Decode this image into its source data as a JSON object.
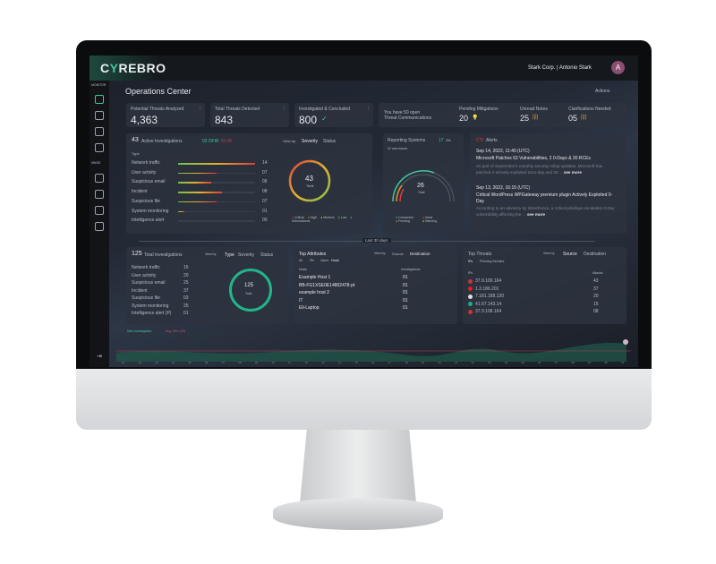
{
  "brand": {
    "logo": "CYREBRO"
  },
  "header": {
    "account": "Stark Corp. | Antonio Stark",
    "avatar": "A"
  },
  "sidebar": {
    "monitor": "MONITOR",
    "manage": "MNGE",
    "icons": [
      "activity-icon",
      "search-doc-icon",
      "cloud-icon",
      "grid-icon",
      "user-icon",
      "doc-icon",
      "shield-icon",
      "settings-icon"
    ]
  },
  "page": {
    "title": "Operations Center",
    "actions": "Actions"
  },
  "stats": [
    {
      "label": "Potential Threats Analyzed",
      "value": "4,363"
    },
    {
      "label": "Total Threats Detected",
      "value": "843"
    },
    {
      "label": "Investigated & Concluded",
      "value": "800"
    }
  ],
  "comms": {
    "text1": "You have 50 open",
    "text2": "Threat Communications",
    "items": [
      {
        "label": "Pending Mitigations",
        "value": "20"
      },
      {
        "label": "Unread Notes",
        "value": "25"
      },
      {
        "label": "Clarifications Needed",
        "value": "05"
      }
    ]
  },
  "active": {
    "count": "43",
    "label": "Active Investigations",
    "dfir": "02 DFIR",
    "ir": "01 IR",
    "viewby": "View by:",
    "tabs": [
      "Severity",
      "Status"
    ],
    "type_header": "Type",
    "total": "43",
    "total_label": "Total",
    "rows": [
      {
        "label": "Network traffic",
        "value": "14",
        "pct": 100
      },
      {
        "label": "User activity",
        "value": "07",
        "pct": 50
      },
      {
        "label": "Suspicious email",
        "value": "06",
        "pct": 43
      },
      {
        "label": "Incident",
        "value": "08",
        "pct": 57
      },
      {
        "label": "Suspicious file",
        "value": "07",
        "pct": 50
      },
      {
        "label": "System monitoring",
        "value": "01",
        "pct": 8
      },
      {
        "label": "Intelligence alert",
        "value": "00",
        "pct": 0
      }
    ],
    "legend": [
      "Critical",
      "High",
      "Medium",
      "Low",
      "Informational"
    ]
  },
  "reporting": {
    "title": "Reporting Systems",
    "count": "17",
    "of": "/26",
    "sub": "02 new issues",
    "total": "26",
    "total_label": "Total",
    "legend": [
      "Connected",
      "None",
      "Pending",
      "Warning"
    ]
  },
  "cti": {
    "title_accent": "CTI",
    "title": "Alerts",
    "alerts": [
      {
        "date": "Sep 14, 2022, 11:40 (UTC)",
        "title": "Microsoft Patches 63 Vulnerabilities, 2 0-Days & 30 RCEs",
        "body": "As part of September's monthly security rollup updates, Microsoft has patched 2 actively exploited Zero-day and 30 ...",
        "more": "see more"
      },
      {
        "date": "Sep 13, 2022, 16:15 (UTC)",
        "title": "Critical WordPress WPGateway premium plugin Actively Exploited 0-Day",
        "body": "According to an advisory by WordFence, a critical privilege escalation 0-Day vulnerability affecting the ...",
        "more": "see more"
      }
    ]
  },
  "range": "Last 30 days",
  "total_inv": {
    "count": "125",
    "label": "Total Investigations",
    "viewby": "View by:",
    "tabs": [
      "Type",
      "Severity",
      "Status"
    ],
    "total": "125",
    "total_label": "Total",
    "rows": [
      {
        "label": "Network traffic",
        "value": "15"
      },
      {
        "label": "User activity",
        "value": "20"
      },
      {
        "label": "Suspicious email",
        "value": "25"
      },
      {
        "label": "Incident",
        "value": "37"
      },
      {
        "label": "Suspicious file",
        "value": "03"
      },
      {
        "label": "System monitoring",
        "value": "25"
      },
      {
        "label": "Intelligence alert (P)",
        "value": "01"
      }
    ]
  },
  "attributes": {
    "title": "Top Attributes",
    "viewby": "View by:",
    "tabs": [
      "Source",
      "Destination"
    ],
    "filters": [
      "All",
      "IPs",
      "Users",
      "Hosts"
    ],
    "col1": "Hosts",
    "col2": "Investigations",
    "rows": [
      {
        "host": "Example Host 1",
        "value": "01"
      },
      {
        "host": "BB-FG1XSE0E14802478-pt",
        "value": "01"
      },
      {
        "host": "example host 2",
        "value": "01"
      },
      {
        "host": "IT",
        "value": "01"
      },
      {
        "host": "Eli-Laptop",
        "value": "01"
      }
    ]
  },
  "threats": {
    "title": "Top Threats",
    "viewby": "View by:",
    "tabs": [
      "Source",
      "Destination"
    ],
    "filters": [
      "IPs",
      "Phishing Senders"
    ],
    "col1": "IPs",
    "col2": "Attacks",
    "rows": [
      {
        "ip": "37.9.109.164",
        "value": "43",
        "flag": "#c33"
      },
      {
        "ip": "1.3.186.201",
        "value": "37",
        "flag": "#d22"
      },
      {
        "ip": "7.181.188.130",
        "value": "20",
        "flag": "#ddd"
      },
      {
        "ip": "41.67.143.14",
        "value": "15",
        "flag": "#2a8"
      },
      {
        "ip": "37.9.108.164",
        "value": "08",
        "flag": "#c33"
      }
    ]
  },
  "timeline": {
    "legend": [
      "New investigation",
      "Avg. New (09)"
    ],
    "x_labels": [
      "01",
      "02",
      "03",
      "04",
      "05",
      "06",
      "07",
      "08",
      "09",
      "10",
      "11",
      "12",
      "13",
      "14",
      "15",
      "16",
      "17",
      "18",
      "19",
      "20",
      "21",
      "22",
      "23",
      "24",
      "25",
      "26",
      "27",
      "28",
      "29",
      "30",
      "31"
    ]
  }
}
